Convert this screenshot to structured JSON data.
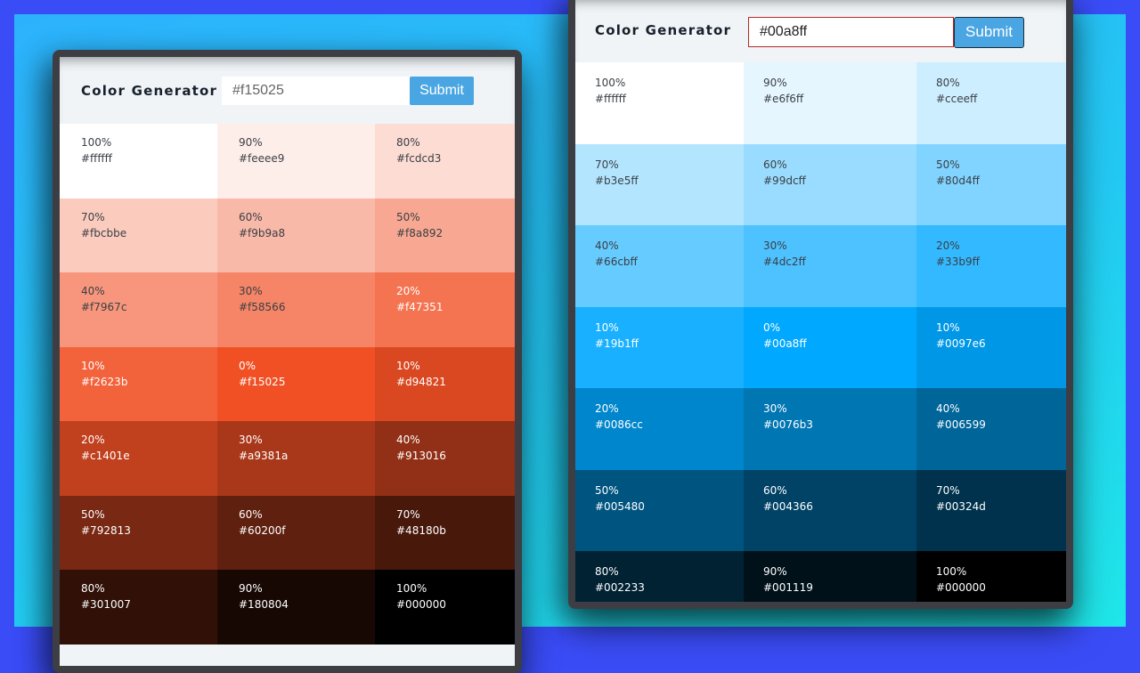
{
  "left": {
    "title": "Color Generator",
    "input_value": "#f15025",
    "submit_label": "Submit",
    "cells": [
      [
        "100%",
        "#ffffff"
      ],
      [
        "90%",
        "#feeee9"
      ],
      [
        "80%",
        "#fcdcd3"
      ],
      [
        "70%",
        "#fbcbbe"
      ],
      [
        "60%",
        "#f9b9a8"
      ],
      [
        "50%",
        "#f8a892"
      ],
      [
        "40%",
        "#f7967c"
      ],
      [
        "30%",
        "#f58566"
      ],
      [
        "20%",
        "#f47351"
      ],
      [
        "10%",
        "#f2623b"
      ],
      [
        "0%",
        "#f15025"
      ],
      [
        "10%",
        "#d94821"
      ],
      [
        "20%",
        "#c1401e"
      ],
      [
        "30%",
        "#a9381a"
      ],
      [
        "40%",
        "#913016"
      ],
      [
        "50%",
        "#792813"
      ],
      [
        "60%",
        "#60200f"
      ],
      [
        "70%",
        "#48180b"
      ],
      [
        "80%",
        "#301007"
      ],
      [
        "90%",
        "#180804"
      ],
      [
        "100%",
        "#000000"
      ]
    ]
  },
  "right": {
    "title": "Color Generator",
    "input_value": "#00a8ff",
    "submit_label": "Submit",
    "cells": [
      [
        "100%",
        "#ffffff"
      ],
      [
        "90%",
        "#e6f6ff"
      ],
      [
        "80%",
        "#cceeff"
      ],
      [
        "70%",
        "#b3e5ff"
      ],
      [
        "60%",
        "#99dcff"
      ],
      [
        "50%",
        "#80d4ff"
      ],
      [
        "40%",
        "#66cbff"
      ],
      [
        "30%",
        "#4dc2ff"
      ],
      [
        "20%",
        "#33b9ff"
      ],
      [
        "10%",
        "#19b1ff"
      ],
      [
        "0%",
        "#00a8ff"
      ],
      [
        "10%",
        "#0097e6"
      ],
      [
        "20%",
        "#0086cc"
      ],
      [
        "30%",
        "#0076b3"
      ],
      [
        "40%",
        "#006599"
      ],
      [
        "50%",
        "#005480"
      ],
      [
        "60%",
        "#004366"
      ],
      [
        "70%",
        "#00324d"
      ],
      [
        "80%",
        "#002233"
      ],
      [
        "90%",
        "#001119"
      ],
      [
        "100%",
        "#000000"
      ]
    ]
  },
  "colors": {
    "background": "#3a4cf6",
    "button": "#4aa6e3",
    "frame": "#3d3e43"
  }
}
